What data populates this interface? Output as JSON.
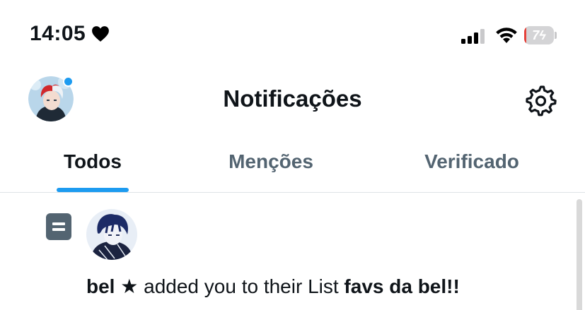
{
  "status_bar": {
    "time": "14:05",
    "battery_level": "7",
    "battery_fraction": 0.07
  },
  "header": {
    "title": "Notificações",
    "settings_icon": "gear-icon"
  },
  "tabs": [
    {
      "label": "Todos",
      "active": true
    },
    {
      "label": "Menções",
      "active": false
    },
    {
      "label": "Verificado",
      "active": false
    }
  ],
  "notification": {
    "type_icon": "list-icon",
    "user_name": "bel ★",
    "action_text": " added you to their List ",
    "list_name": "favs da bel!!"
  },
  "colors": {
    "accent": "#1d9bf0",
    "text_primary": "#0f1419",
    "text_secondary": "#536471",
    "battery_low": "#e5413a"
  }
}
